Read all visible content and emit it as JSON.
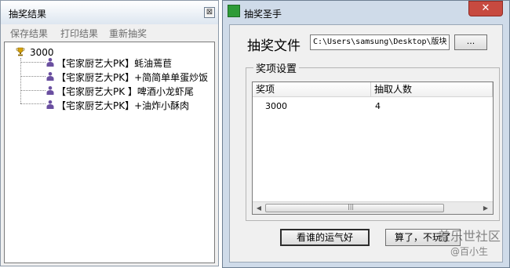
{
  "left_window": {
    "title": "抽奖结果",
    "close_glyph": "⊠",
    "toolbar": {
      "save_label": "保存结果",
      "print_label": "打印结果",
      "redraw_label": "重新抽奖"
    },
    "tree": {
      "root_label": "3000",
      "root_icon": "trophy-icon",
      "children": [
        {
          "label": "【宅家厨艺大PK】蚝油蔫苣",
          "icon": "person-icon"
        },
        {
          "label": "【宅家厨艺大PK】+简简单单蛋炒饭",
          "icon": "person-icon"
        },
        {
          "label": "【宅家厨艺大PK 】啤酒小龙虾尾",
          "icon": "person-icon"
        },
        {
          "label": "【宅家厨艺大PK】+油炸小酥肉",
          "icon": "person-icon"
        }
      ]
    }
  },
  "right_window": {
    "title": "抽奖圣手",
    "close_glyph": "✕",
    "file": {
      "label": "抽奖文件",
      "value": "C:\\Users\\samsung\\Desktop\\版块",
      "browse_label": "..."
    },
    "group_label": "奖项设置",
    "table": {
      "columns": [
        "奖项",
        "抽取人数"
      ],
      "rows": [
        {
          "prize": "3000",
          "count": "4"
        }
      ]
    },
    "scroll_left": "◀",
    "scroll_right": "▶",
    "scroll_grip": "|||",
    "buttons": {
      "lucky_label": "看谁的运气好",
      "quit_label": "算了，不玩了"
    }
  },
  "watermark": {
    "line1": "羞乐世社区",
    "line2": "@百小生"
  },
  "colors": {
    "right_frame": "#cfdbe9",
    "close_red": "#c74a40",
    "app_icon_green": "#2e9b38"
  }
}
